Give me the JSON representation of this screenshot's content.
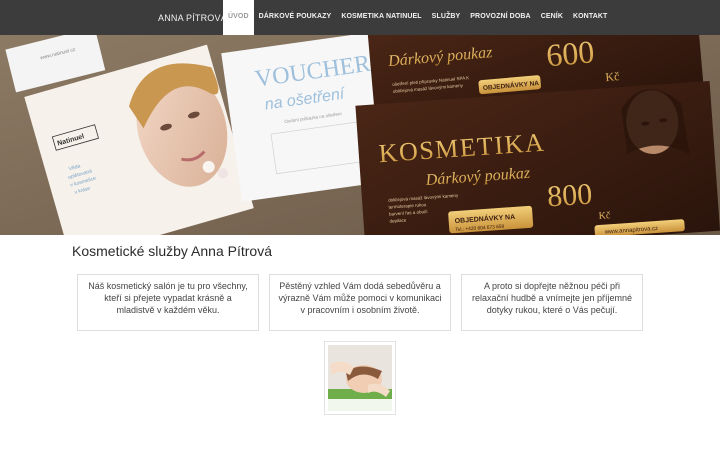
{
  "brand": "ANNA PÍTROVÁ",
  "nav": [
    {
      "label": "ÚVOD",
      "active": true
    },
    {
      "label": "DÁRKOVÉ POUKAZY",
      "active": false
    },
    {
      "label": "KOSMETIKA NATINUEL",
      "active": false
    },
    {
      "label": "SLUŽBY",
      "active": false
    },
    {
      "label": "PROVOZNÍ DOBA",
      "active": false
    },
    {
      "label": "CENÍK",
      "active": false
    },
    {
      "label": "KONTAKT",
      "active": false
    }
  ],
  "hero": {
    "voucher_white_title": "VOUCHER",
    "voucher_white_sub": "na ošetření",
    "voucher_white_line": "Osobní průkazka na ošetření",
    "brand_card": "Natinuel",
    "card_text": [
      "Věda",
      "oplétovaná",
      "v kosmetice",
      "v kráse"
    ],
    "gift_back_title": "Dárkový poukaz",
    "gift_back_price": "600",
    "gift_back_currency": "Kč",
    "gift_back_order": "OBJEDNÁVKY NA",
    "gift_back_items": [
      "ošetření pleti přípravky Natinuel SPA K",
      "obličejová masáž lávovými kameny"
    ],
    "gift_front_title": "KOSMETIKA",
    "gift_front_sub": "Dárkový poukaz",
    "gift_front_price": "800",
    "gift_front_currency": "Kč",
    "gift_front_items": [
      "obličejová masáž lávovými kameny",
      "termoterapie rukou",
      "barvení řas a obočí",
      "depilace"
    ],
    "gift_front_order": "OBJEDNÁVKY NA",
    "gift_front_phone": "Tel.: +420 604 673 658",
    "gift_front_web": "www.annapitrova.cz",
    "card_url": "www.natinuel.cz"
  },
  "content": {
    "title": "Kosmetické služby Anna Pítrová",
    "boxes": [
      "Náš kosmetický salón je tu pro všechny, kteří si přejete vypadat krásně a mladistvě v každém věku.",
      "Pěstěný vzhled Vám dodá sebedůvěru a výrazně Vám může pomoci v komunikaci v pracovním i osobním životě.",
      "A proto si dopřejte něžnou péči při relaxační hudbě a vnímejte jen příjemné dotyky rukou, které o Vás pečují."
    ]
  },
  "colors": {
    "navbar": "#3c3c3c",
    "nav_active_bg": "#ffffff",
    "nav_active_text": "#9a9a9a",
    "gold": "#d9a84a",
    "voucher_dark": "#3a1d12"
  }
}
